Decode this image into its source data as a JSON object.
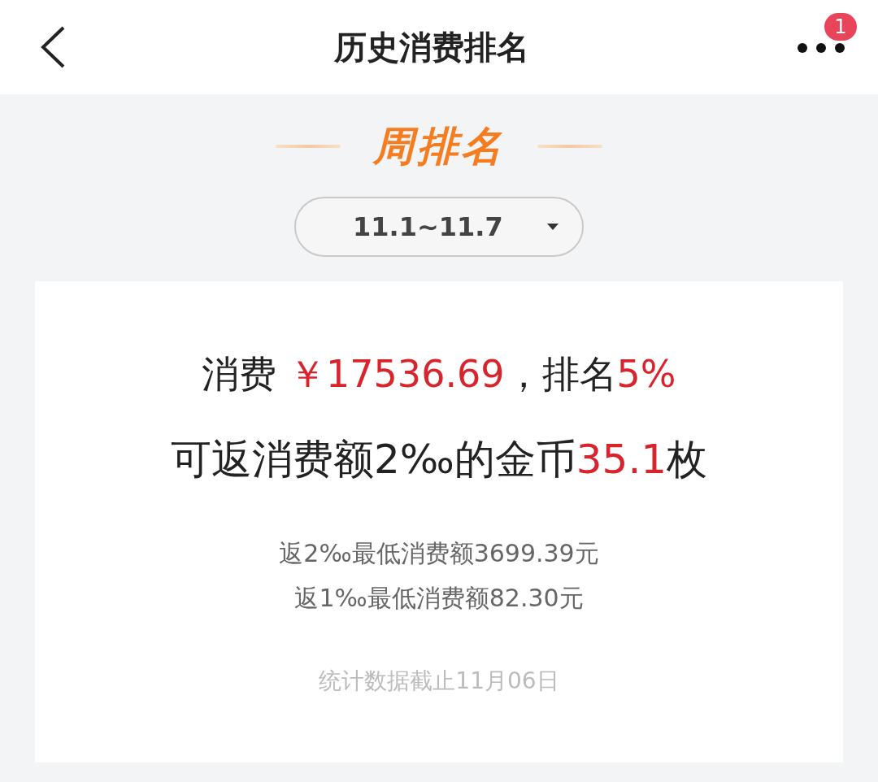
{
  "header": {
    "title": "历史消费排名",
    "badge": "1"
  },
  "section_title": "周排名",
  "period_selector": {
    "value": "11.1~11.7"
  },
  "summary": {
    "lines": [
      [
        {
          "text": "消费 ",
          "highlight": false
        },
        {
          "text": "￥17536.69",
          "highlight": true
        },
        {
          "text": "，排名",
          "highlight": false
        },
        {
          "text": "5%",
          "highlight": true
        }
      ],
      [
        {
          "text": "可返消费额2‰的金币",
          "highlight": false
        },
        {
          "text": "35.1",
          "highlight": true
        },
        {
          "text": "枚",
          "highlight": false
        }
      ]
    ],
    "thresholds": [
      "返2‰最低消费额3699.39元",
      "返1‰最低消费额82.30元"
    ],
    "footnote": "统计数据截止11月06日"
  }
}
